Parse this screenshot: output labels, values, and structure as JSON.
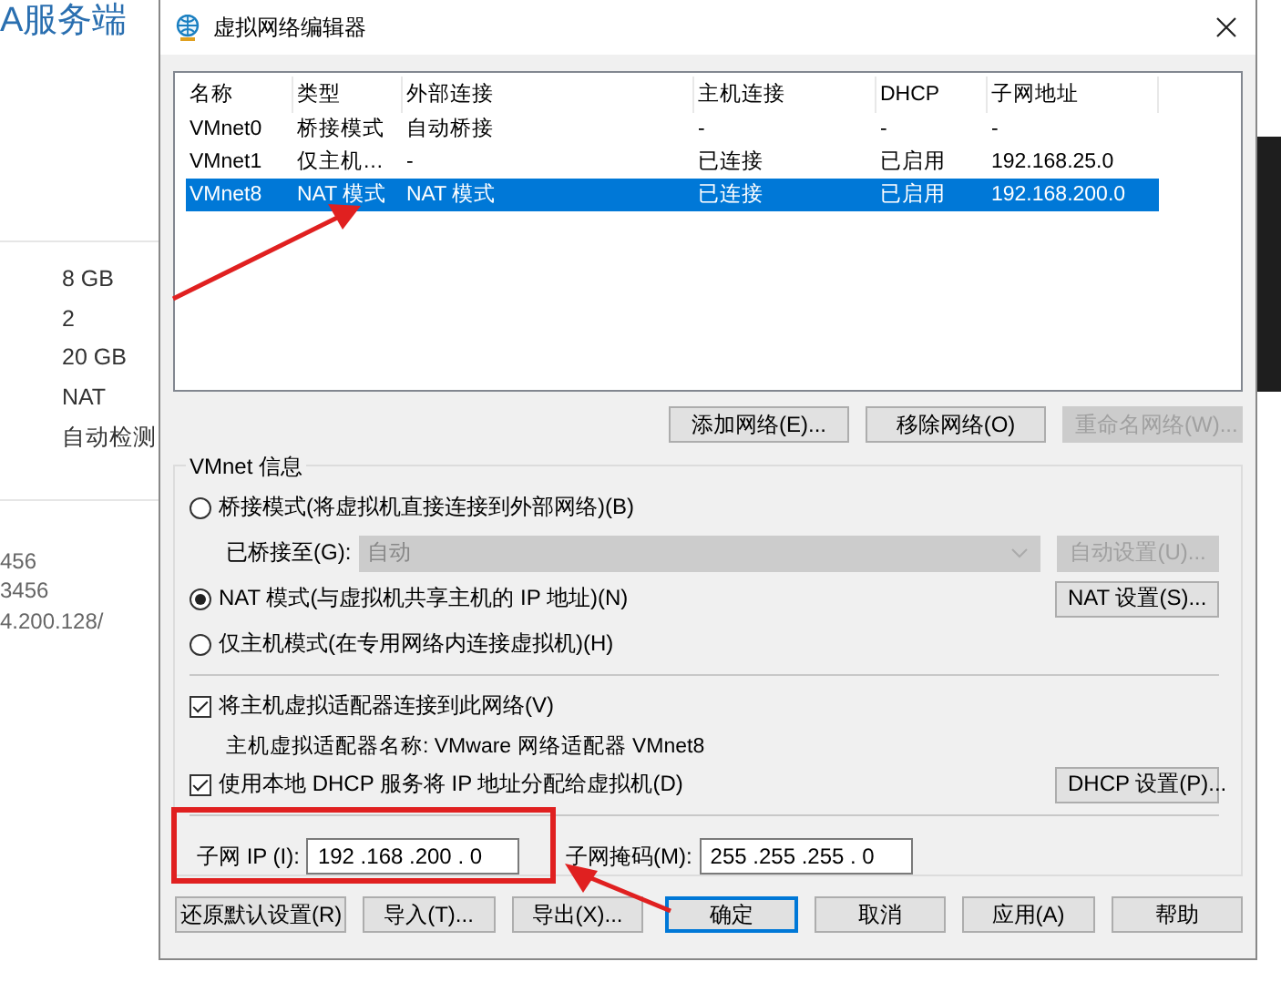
{
  "background_app": {
    "title": "A服务端",
    "specs": [
      "8 GB",
      "2",
      "20 GB",
      "NAT",
      "自动检测"
    ],
    "details": [
      "456",
      "3456",
      "4.200.128/"
    ]
  },
  "window": {
    "title": "虚拟网络编辑器"
  },
  "networks": {
    "columns": [
      "名称",
      "类型",
      "外部连接",
      "主机连接",
      "DHCP",
      "子网地址"
    ],
    "rows": [
      {
        "cells": [
          "VMnet0",
          "桥接模式",
          "自动桥接",
          "-",
          "-",
          "-"
        ],
        "selected": false
      },
      {
        "cells": [
          "VMnet1",
          "仅主机…",
          "-",
          "已连接",
          "已启用",
          "192.168.25.0"
        ],
        "selected": false
      },
      {
        "cells": [
          "VMnet8",
          "NAT 模式",
          "NAT 模式",
          "已连接",
          "已启用",
          "192.168.200.0"
        ],
        "selected": true
      }
    ]
  },
  "list_buttons": [
    {
      "label": "添加网络(E)...",
      "disabled": false
    },
    {
      "label": "移除网络(O)",
      "disabled": false
    },
    {
      "label": "重命名网络(W)...",
      "disabled": true
    }
  ],
  "vmnet_info": {
    "title": "VMnet 信息",
    "bridged": {
      "label": "桥接模式(将虚拟机直接连接到外部网络)(B)",
      "selected": false
    },
    "bridged_to": {
      "label": "已桥接至(G):",
      "value": "自动",
      "disabled": true
    },
    "auto_settings": {
      "label": "自动设置(U)...",
      "disabled": true
    },
    "nat": {
      "label": "NAT 模式(与虚拟机共享主机的 IP 地址)(N)",
      "selected": true
    },
    "nat_settings": {
      "label": "NAT 设置(S)...",
      "disabled": false
    },
    "host_only": {
      "label": "仅主机模式(在专用网络内连接虚拟机)(H)",
      "selected": false
    },
    "connect_adapter": {
      "label": "将主机虚拟适配器连接到此网络(V)",
      "checked": true
    },
    "adapter_name": "主机虚拟适配器名称: VMware 网络适配器 VMnet8",
    "use_dhcp": {
      "label": "使用本地 DHCP 服务将 IP 地址分配给虚拟机(D)",
      "checked": true
    },
    "dhcp_settings": {
      "label": "DHCP 设置(P)...",
      "disabled": false
    },
    "subnet_ip": {
      "label": "子网 IP (I):",
      "value": "192 .168 .200 . 0"
    },
    "subnet_mask": {
      "label": "子网掩码(M):",
      "value": "255 .255 .255 . 0"
    }
  },
  "buttons": [
    {
      "label": "还原默认设置(R)",
      "default": false
    },
    {
      "label": "导入(T)...",
      "default": false
    },
    {
      "label": "导出(X)...",
      "default": false
    },
    {
      "label": "确定",
      "default": true
    },
    {
      "label": "取消",
      "default": false
    },
    {
      "label": "应用(A)",
      "default": false
    },
    {
      "label": "帮助",
      "default": false
    }
  ]
}
